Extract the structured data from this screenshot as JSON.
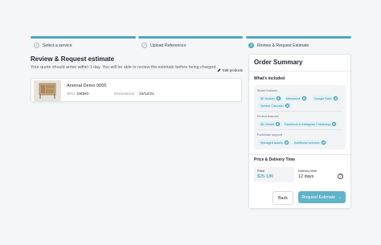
{
  "colors": {
    "accent": "#4fa8c2",
    "accent_light": "#e2f1f6",
    "primary_button": "#5fb4c9",
    "background": "#f5f6f7"
  },
  "stepper": {
    "steps": [
      {
        "label": "Select a service",
        "icon": "check-icon",
        "state": "done"
      },
      {
        "label": "Upload References",
        "icon": "check-icon",
        "state": "done"
      },
      {
        "number": "3",
        "label": "Review & Request Estimate",
        "state": "active"
      }
    ]
  },
  "main": {
    "title": "Review & Request estimate",
    "subtitle": "Your quote should arrive within 1 day. You will be able to review the estimate before being charged.",
    "edit_link": "Edit products",
    "product": {
      "name": "Arsenal Demo 0055",
      "sku_label": "SKU",
      "sku_value": "DEMO",
      "sku_separator": "-",
      "dimensions_label": "Dimensions",
      "dimensions_value": "23/12/21"
    }
  },
  "summary": {
    "title": "Order Summary",
    "whats_included": "What's included",
    "groups": [
      {
        "label": "Model features",
        "chips": [
          "3D models",
          "Metaverse",
          "Google Swirl",
          "Sphere Carousel"
        ]
      },
      {
        "label": "Embed features",
        "chips": [
          "3D Viewer",
          "Facebook & Instagram Publishing"
        ]
      },
      {
        "label": "Pathfinder support",
        "chips": [
          "Managed assets",
          "Additional services"
        ]
      }
    ],
    "price_delivery_title": "Price & Delivery Time",
    "price_label": "Price",
    "price_value": "$25-180",
    "delivery_label": "Delivery time",
    "delivery_value": "12 days",
    "back_label": "Back",
    "request_label": "Request Estimate",
    "request_arrow": "→"
  }
}
